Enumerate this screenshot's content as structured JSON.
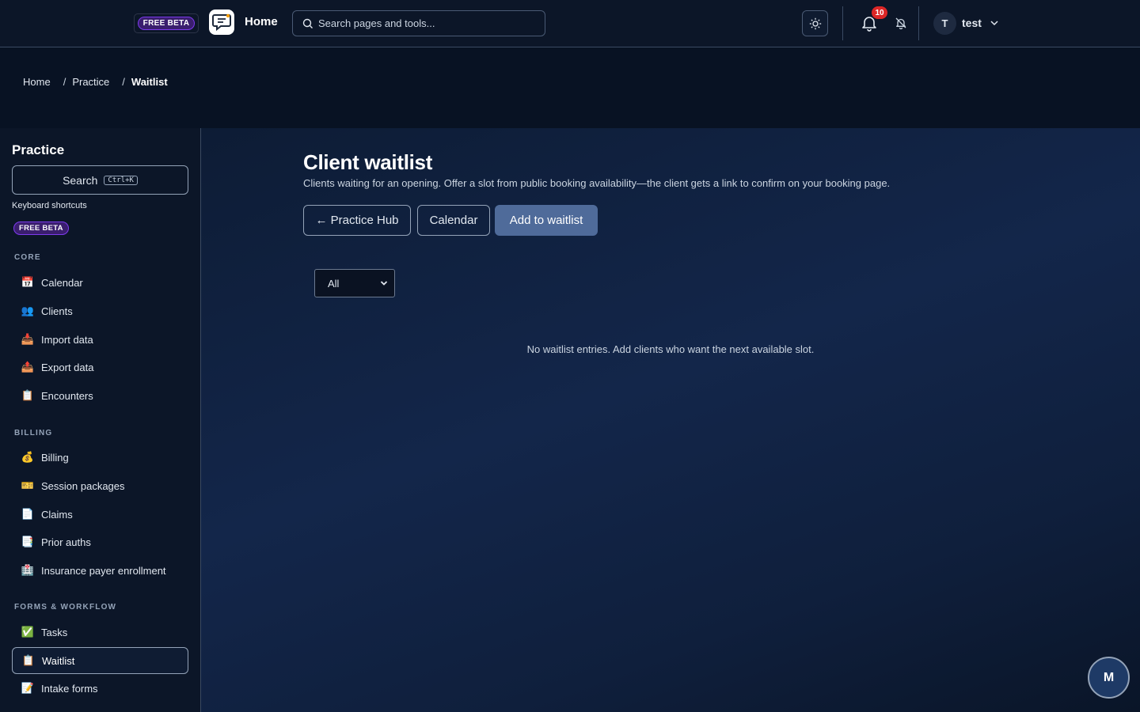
{
  "header": {
    "beta_badge": "FREE BETA",
    "home_label": "Home",
    "search_placeholder": "Search pages and tools...",
    "notification_count": "10",
    "avatar_initial": "T",
    "username": "test"
  },
  "breadcrumb": {
    "items": [
      "Home",
      "Practice",
      "Waitlist"
    ],
    "separator": "/"
  },
  "sidebar": {
    "title": "Practice",
    "search_label": "Search",
    "search_shortcut": "Ctrl+K",
    "shortcuts_link": "Keyboard shortcuts",
    "beta_badge": "FREE BETA",
    "sections": [
      {
        "label": "CORE",
        "items": [
          {
            "icon": "calendar-icon",
            "glyph": "📅",
            "label": "Calendar"
          },
          {
            "icon": "clients-icon",
            "glyph": "👥",
            "label": "Clients"
          },
          {
            "icon": "import-icon",
            "glyph": "📥",
            "label": "Import data"
          },
          {
            "icon": "export-icon",
            "glyph": "📤",
            "label": "Export data"
          },
          {
            "icon": "clipboard-icon",
            "glyph": "📋",
            "label": "Encounters"
          }
        ]
      },
      {
        "label": "BILLING",
        "items": [
          {
            "icon": "money-bag-icon",
            "glyph": "💰",
            "label": "Billing"
          },
          {
            "icon": "ticket-icon",
            "glyph": "🎫",
            "label": "Session packages"
          },
          {
            "icon": "document-icon",
            "glyph": "📄",
            "label": "Claims"
          },
          {
            "icon": "page-icon",
            "glyph": "📑",
            "label": "Prior auths"
          },
          {
            "icon": "hospital-icon",
            "glyph": "🏥",
            "label": "Insurance payer enrollment"
          }
        ]
      },
      {
        "label": "FORMS & WORKFLOW",
        "items": [
          {
            "icon": "check-icon",
            "glyph": "✅",
            "label": "Tasks"
          },
          {
            "icon": "clipboard-icon",
            "glyph": "📋",
            "label": "Waitlist"
          },
          {
            "icon": "memo-icon",
            "glyph": "📝",
            "label": "Intake forms"
          }
        ]
      }
    ]
  },
  "main": {
    "title": "Client waitlist",
    "subtitle": "Clients waiting for an opening. Offer a slot from public booking availability—the client gets a link to confirm on your booking page.",
    "buttons": {
      "back": "← Practice Hub",
      "calendar": "Calendar",
      "add": "Add to waitlist"
    },
    "filter": {
      "selected": "All"
    },
    "empty_message": "No waitlist entries. Add clients who want the next available slot."
  },
  "fab": {
    "label": "M"
  },
  "colors": {
    "accent_primary": "#4f6b9a",
    "beta_purple": "#7c3aed",
    "badge_red": "#dc2626"
  }
}
